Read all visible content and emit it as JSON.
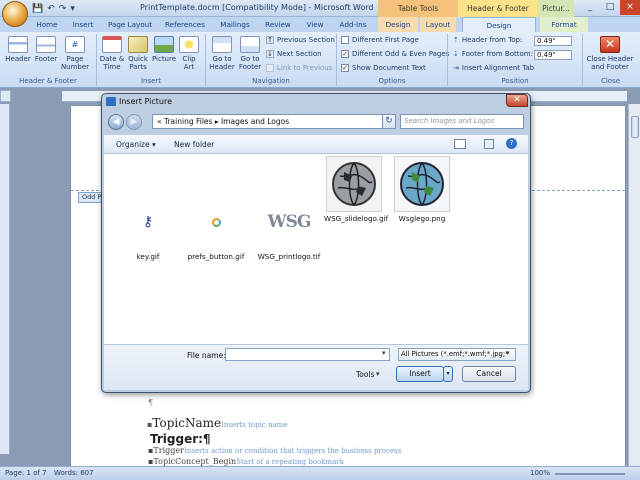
{
  "window": {
    "title": "PrintTemplate.docm [Compatibility Mode] - Microsoft Word",
    "contextual_headers": [
      "Table Tools",
      "Header & Footer Tools",
      "Pictur..."
    ],
    "controls": [
      "_",
      "□",
      "×"
    ]
  },
  "qat": {
    "save": "💾",
    "undo": "↶",
    "redo": "↷",
    "more": "▾"
  },
  "tabs": [
    "Home",
    "Insert",
    "Page Layout",
    "References",
    "Mailings",
    "Review",
    "View",
    "Add-Ins",
    "Design",
    "Layout",
    "Design",
    "Format"
  ],
  "ribbon": {
    "header_footer_group": {
      "label": "Header & Footer",
      "buttons": [
        "Header",
        "Footer",
        "Page Number"
      ]
    },
    "insert_group": {
      "label": "Insert",
      "buttons": [
        "Date & Time",
        "Quick Parts",
        "Picture",
        "Clip Art"
      ]
    },
    "navigation_group": {
      "label": "Navigation",
      "buttons": [
        "Go to Header",
        "Go to Footer"
      ],
      "links": [
        "Previous Section",
        "Next Section",
        "Link to Previous"
      ]
    },
    "options_group": {
      "label": "Options",
      "items": [
        {
          "label": "Different First Page",
          "checked": false
        },
        {
          "label": "Different Odd & Even Pages",
          "checked": true
        },
        {
          "label": "Show Document Text",
          "checked": true
        }
      ]
    },
    "position_group": {
      "label": "Position",
      "header_from_top_label": "Header from Top:",
      "header_from_top": "0.49\"",
      "footer_from_bottom_label": "Footer from Bottom:",
      "footer_from_bottom": "0.49\"",
      "insert_alignment_tab": "Insert Alignment Tab"
    },
    "close_group": {
      "label": "Close",
      "button": "Close Header and Footer"
    }
  },
  "document": {
    "header_tag": "Odd P",
    "pilcrow": "¶",
    "topic_name": "TopicName",
    "topic_name_hint": "Inserts topic name",
    "trigger_heading": "Trigger:¶",
    "trigger_label": "Trigger",
    "trigger_hint": "Inserts action or condition that triggers the business process",
    "topic_concept": "TopicConcept_Begin",
    "topic_concept_hint": "Start of a repeating bookmark"
  },
  "dialog": {
    "title": "Insert Picture",
    "breadcrumb": [
      "Training Files",
      "Images and Logos"
    ],
    "search_placeholder": "Search Images and Logos",
    "organize": "Organize ▾",
    "new_folder": "New folder",
    "files": [
      {
        "name": "key.gif",
        "icon": "key-icon"
      },
      {
        "name": "prefs_button.gif",
        "icon": "prefs-icon"
      },
      {
        "name": "WSG_printlogo.tif",
        "icon": "wsg-text-logo"
      },
      {
        "name": "WSG_slidelogo.gif",
        "icon": "globe-grey-icon"
      },
      {
        "name": "Wsglego.png",
        "icon": "globe-color-icon"
      }
    ],
    "file_name_label": "File name:",
    "file_name_value": "",
    "filter": "All Pictures (*.emf;*.wmf;*.jpg;*",
    "tools": "Tools",
    "insert": "Insert",
    "cancel": "Cancel"
  },
  "status": {
    "page": "Page: 1 of 7",
    "words": "Words: 607",
    "zoom": "100%"
  },
  "colors": {
    "ribbon": "#dbe7f6",
    "accent": "#15428b",
    "dialog_frame": "#bfcde0"
  }
}
